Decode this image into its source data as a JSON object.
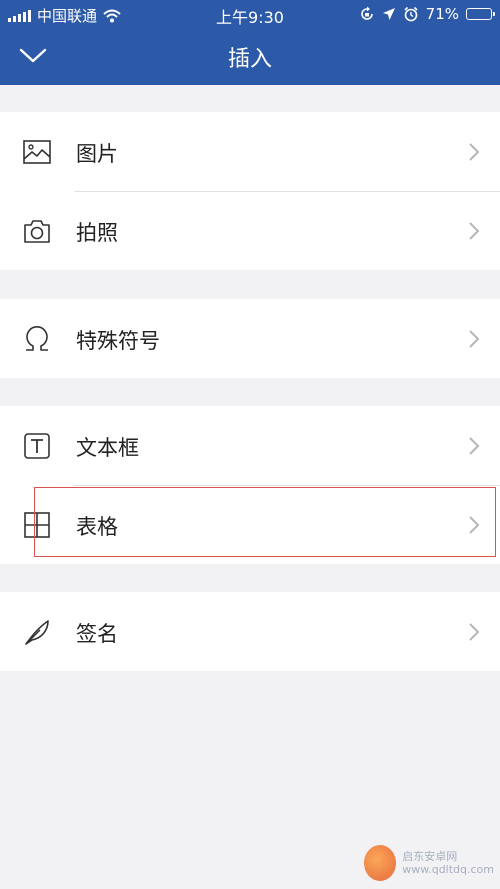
{
  "status_bar": {
    "carrier": "中国联通",
    "time": "上午9:30",
    "battery": "71%",
    "battery_level": 0.71,
    "icons": [
      "signal-icon",
      "wifi-icon",
      "rotation-lock-icon",
      "location-icon",
      "alarm-icon",
      "battery-icon"
    ]
  },
  "nav": {
    "title": "插入",
    "back_icon": "chevron-down-icon"
  },
  "groups": [
    {
      "items": [
        {
          "label": "图片",
          "icon": "image-icon"
        },
        {
          "label": "拍照",
          "icon": "camera-icon"
        }
      ]
    },
    {
      "items": [
        {
          "label": "特殊符号",
          "icon": "omega-icon"
        }
      ]
    },
    {
      "items": [
        {
          "label": "文本框",
          "icon": "textbox-icon"
        },
        {
          "label": "表格",
          "icon": "table-icon",
          "highlighted": true
        }
      ]
    },
    {
      "items": [
        {
          "label": "签名",
          "icon": "feather-pen-icon"
        }
      ]
    }
  ],
  "colors": {
    "nav_background": "#2c5aa9",
    "page_background": "#f2f2f4",
    "highlight_border": "#d9534f"
  },
  "watermark": {
    "name": "启东安卓网",
    "url": "www.qdltdq.com"
  }
}
